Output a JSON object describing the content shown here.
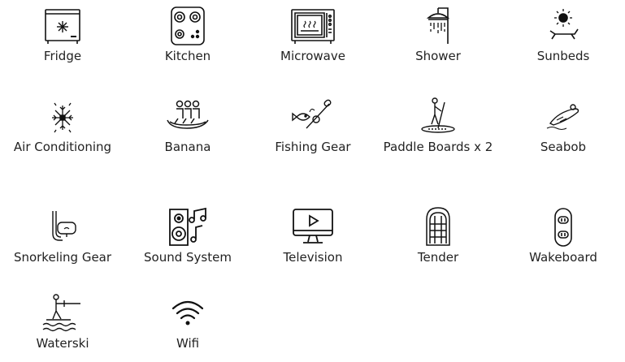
{
  "amenities": [
    {
      "label": "Fridge",
      "icon": "fridge-icon"
    },
    {
      "label": "Kitchen",
      "icon": "stove-icon"
    },
    {
      "label": "Microwave",
      "icon": "microwave-icon"
    },
    {
      "label": "Shower",
      "icon": "shower-icon"
    },
    {
      "label": "Sunbeds",
      "icon": "sunbed-icon"
    },
    {
      "label": "Air Conditioning",
      "icon": "snowflake-icon"
    },
    {
      "label": "Banana",
      "icon": "banana-boat-icon"
    },
    {
      "label": "Fishing Gear",
      "icon": "fishing-rod-icon"
    },
    {
      "label": "Paddle Boards x 2",
      "icon": "paddle-board-icon"
    },
    {
      "label": "Seabob",
      "icon": "seabob-icon"
    },
    {
      "label": "Snorkeling Gear",
      "icon": "snorkel-mask-icon"
    },
    {
      "label": "Sound System",
      "icon": "speaker-music-icon"
    },
    {
      "label": "Television",
      "icon": "tv-icon"
    },
    {
      "label": "Tender",
      "icon": "dinghy-icon"
    },
    {
      "label": "Wakeboard",
      "icon": "wakeboard-icon"
    },
    {
      "label": "Waterski",
      "icon": "waterski-icon"
    },
    {
      "label": "Wifi",
      "icon": "wifi-icon"
    }
  ]
}
